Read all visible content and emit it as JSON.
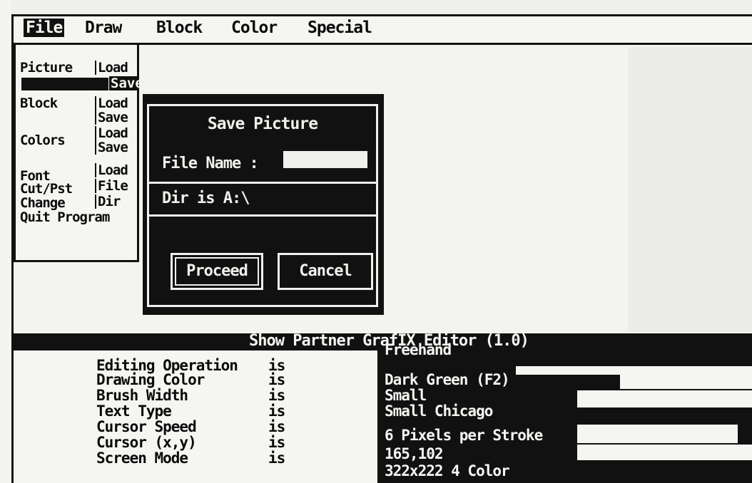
{
  "menubar": {
    "items": [
      {
        "label": "File",
        "active": true
      },
      {
        "label": "Draw"
      },
      {
        "label": "Block"
      },
      {
        "label": "Color"
      },
      {
        "label": "Special"
      }
    ]
  },
  "left_menu": {
    "rows": [
      {
        "left": "Picture",
        "right": "Load"
      },
      {
        "left": "",
        "right": "Save",
        "highlighted": true
      },
      {
        "left": "Block",
        "right": "Load"
      },
      {
        "left": "",
        "right": "Save"
      },
      {
        "left": "Colors",
        "right": "Load"
      },
      {
        "left": "",
        "right": "Save"
      },
      {
        "left": "Font",
        "right": "Load"
      },
      {
        "left": "Cut/Pst",
        "right": "File"
      },
      {
        "left": "Change",
        "right": "Dir"
      },
      {
        "left": "Quit Program",
        "right": ""
      }
    ]
  },
  "dialog": {
    "title": "Save Picture",
    "file_name_label": "File Name :",
    "file_name_value": "",
    "dir_text": "Dir is A:\\",
    "proceed_label": "Proceed",
    "cancel_label": "Cancel"
  },
  "status": {
    "title": "Show Partner GrafIX Editor (1.0)",
    "rows": [
      {
        "label": "Editing Operation",
        "is": "is",
        "value": "Freehand"
      },
      {
        "label": "Drawing Color",
        "is": "is",
        "value": "Dark Green (F2)"
      },
      {
        "label": "Brush Width",
        "is": "is",
        "value": "Small"
      },
      {
        "label": "Text Type",
        "is": "is",
        "value": "Small Chicago"
      },
      {
        "label": "Cursor Speed",
        "is": "is",
        "value": "6 Pixels per Stroke"
      },
      {
        "label": "Cursor (x,y)",
        "is": "is",
        "value": "165,102"
      },
      {
        "label": "Screen Mode",
        "is": "is",
        "value": "322x222 4 Color"
      }
    ]
  },
  "colors": {
    "ink": "#111111",
    "paper": "#f5f5f2"
  }
}
